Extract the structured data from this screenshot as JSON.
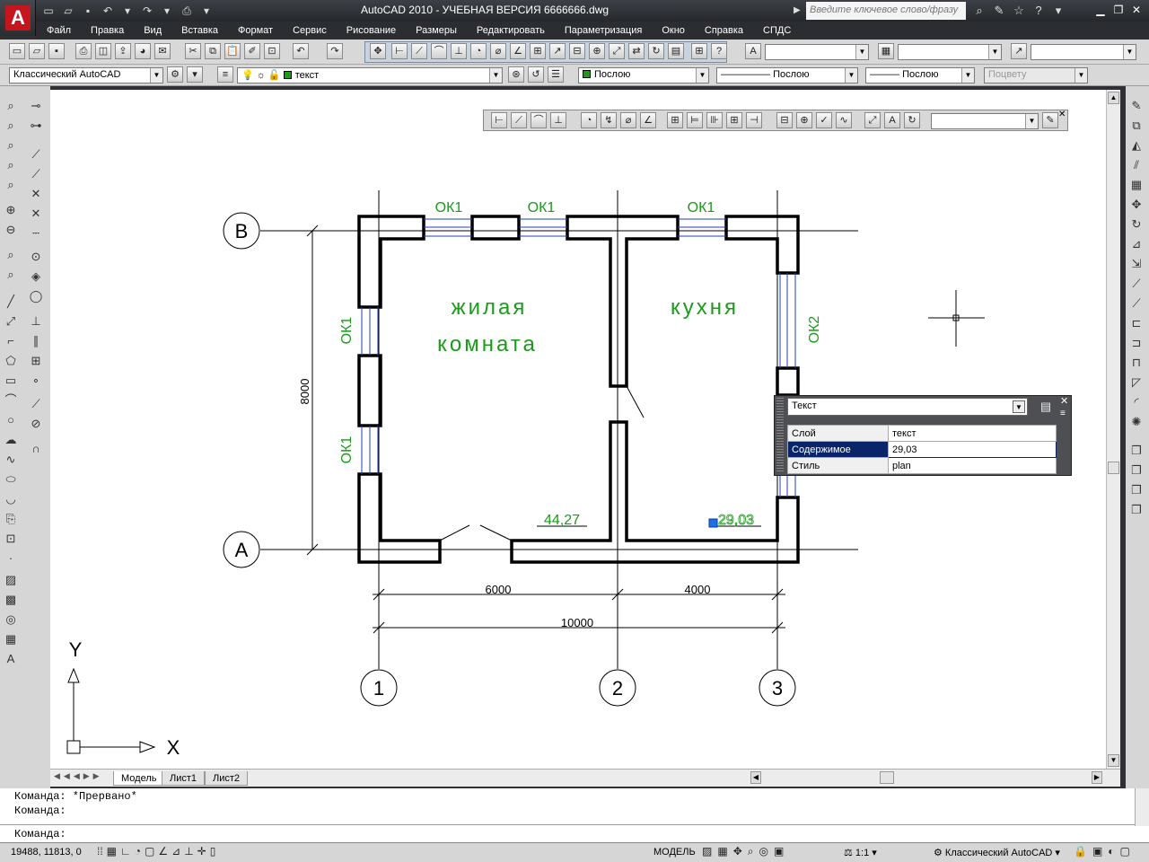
{
  "app": {
    "title": "AutoCAD 2010 - УЧЕБНАЯ ВЕРСИЯ     6666666.dwg",
    "logo_letter": "A",
    "search_placeholder": "Введите ключевое слово/фразу"
  },
  "menu": [
    "Файл",
    "Правка",
    "Вид",
    "Вставка",
    "Формат",
    "Сервис",
    "Рисование",
    "Размеры",
    "Редактировать",
    "Параметризация",
    "Окно",
    "Справка",
    "СПДС"
  ],
  "toolbars": {
    "workspace": "Классический AutoCAD",
    "layer": "текст",
    "color": "Послою",
    "linetype": "Послою",
    "lineweight": "Послою",
    "plotstyle": "Поцвету"
  },
  "drawing": {
    "axes_letters": [
      "В",
      "А"
    ],
    "axes_numbers": [
      "1",
      "2",
      "3"
    ],
    "rooms": [
      "жилая",
      "комната",
      "кухня"
    ],
    "areas": [
      "44,27",
      "29,03"
    ],
    "windows": [
      "ОК1",
      "ОК1",
      "ОК1",
      "ОК1",
      "ОК1",
      "ОК2"
    ],
    "dims": {
      "d1": "6000",
      "d2": "4000",
      "total": "10000",
      "height": "8000"
    },
    "ucs": {
      "x": "X",
      "y": "Y"
    }
  },
  "quick_properties": {
    "object_type": "Текст",
    "rows": [
      {
        "key": "Слой",
        "value": "текст"
      },
      {
        "key": "Содержимое",
        "value": "29,03"
      },
      {
        "key": "Стиль",
        "value": "plan"
      }
    ]
  },
  "tabs": [
    "Модель",
    "Лист1",
    "Лист2"
  ],
  "command_lines": [
    "Команда: *Прервано*",
    "Команда:",
    "Команда:"
  ],
  "status": {
    "coords": "19488, 11813, 0",
    "model": "МОДЕЛЬ",
    "scale": "1:1",
    "workspace": "Классический AutoCAD"
  },
  "colors": {
    "accent": "#c4161c",
    "green_text": "#1a9b1a",
    "window_blue": "#1c3fb8"
  }
}
